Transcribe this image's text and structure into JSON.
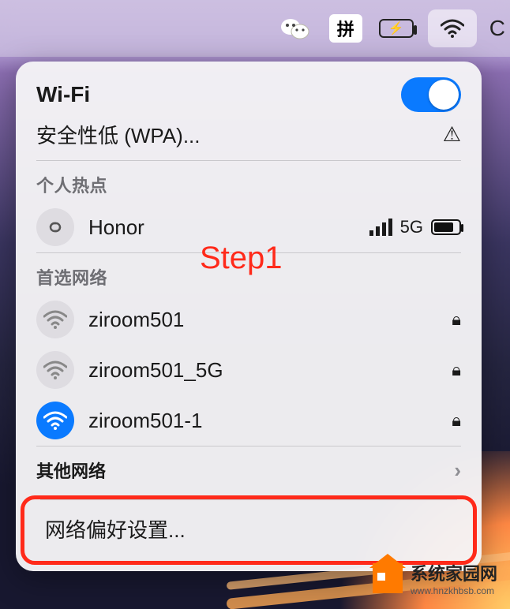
{
  "menubar": {
    "ime_label": "拼"
  },
  "wifi": {
    "title": "Wi-Fi",
    "toggle_on": true,
    "security_warning": "安全性低 (WPA)...",
    "hotspot_section": "个人热点",
    "hotspot": {
      "name": "Honor",
      "signal_label": "5G"
    },
    "preferred_section": "首选网络",
    "networks": [
      {
        "name": "ziroom501",
        "locked": true,
        "active": false
      },
      {
        "name": "ziroom501_5G",
        "locked": true,
        "active": false
      },
      {
        "name": "ziroom501-1",
        "locked": true,
        "active": true
      }
    ],
    "other_section": "其他网络",
    "preferences": "网络偏好设置..."
  },
  "annotation": "Step1",
  "watermark": {
    "cn": "系统家园网",
    "en": "www.hnzkhbsb.com"
  }
}
